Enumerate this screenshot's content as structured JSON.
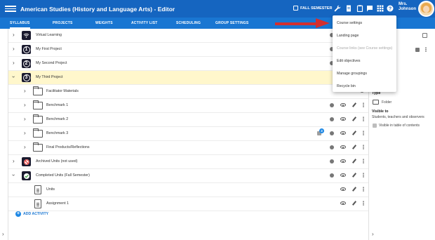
{
  "header": {
    "title": "American Studies (History and Language Arts) - Editor",
    "semester_label": "FALL SEMESTER",
    "user_name_line1": "Mrs.",
    "user_name_line2": "Johnson",
    "icons": [
      "wrench-icon",
      "document-icon",
      "clipboard-icon",
      "flag-icon",
      "grid-icon",
      "help-icon"
    ]
  },
  "tabs": [
    {
      "label": "SYLLABUS",
      "active": true
    },
    {
      "label": "PROJECTS",
      "active": false
    },
    {
      "label": "WEIGHTS",
      "active": false
    },
    {
      "label": "ACTIVITY LIST",
      "active": false
    },
    {
      "label": "SCHEDULING",
      "active": false
    },
    {
      "label": "GROUP SETTINGS",
      "active": false
    }
  ],
  "rows": [
    {
      "label": "Virtual Learning",
      "icon": "wifi-icon"
    },
    {
      "label": "My First Project",
      "icon": "number-1-icon",
      "num": "1"
    },
    {
      "label": "My Second Project",
      "icon": "number-2-icon",
      "num": "2"
    },
    {
      "label": "My Third Project",
      "icon": "number-3-icon",
      "num": "3"
    },
    {
      "label": "Facilitator Materials",
      "icon": "folder-icon"
    },
    {
      "label": "Benchmark 1",
      "icon": "folder-icon"
    },
    {
      "label": "Benchmark 2",
      "icon": "folder-icon"
    },
    {
      "label": "Benchmark 3",
      "icon": "folder-icon",
      "badge": "3"
    },
    {
      "label": "Final Products/Reflections",
      "icon": "folder-icon"
    },
    {
      "label": "Archived Units (not used)",
      "icon": "no-entry-icon"
    },
    {
      "label": "Completed Units (Fall Semester)",
      "icon": "checkmark-icon"
    },
    {
      "label": "Units",
      "icon": "document-icon"
    },
    {
      "label": "Assignment 1",
      "icon": "document-icon"
    }
  ],
  "add_activity": {
    "label": "ADD ACTIVITY",
    "plus": "+"
  },
  "menu": {
    "items": [
      {
        "label": "Course settings",
        "disabled": false
      },
      {
        "label": "Landing page",
        "disabled": false
      },
      {
        "label": "Course links (see Course settings)",
        "disabled": true
      },
      {
        "label": "Edit objectives",
        "disabled": false
      },
      {
        "label": "Manage groupings",
        "disabled": false
      },
      {
        "label": "Recycle bin",
        "disabled": false
      }
    ]
  },
  "right_panel": {
    "type_heading": "Type",
    "type_value": "Folder",
    "visible_heading": "Visible to",
    "visible_value": "Students, teachers and observers",
    "toc_label": "Visible in table of contents"
  },
  "colors": {
    "header_bg": "#1565c0",
    "tab_bg": "#1976d2",
    "highlight_row": "#fff7cc",
    "arrow": "#d32f2f",
    "accent": "#1e88e5"
  }
}
